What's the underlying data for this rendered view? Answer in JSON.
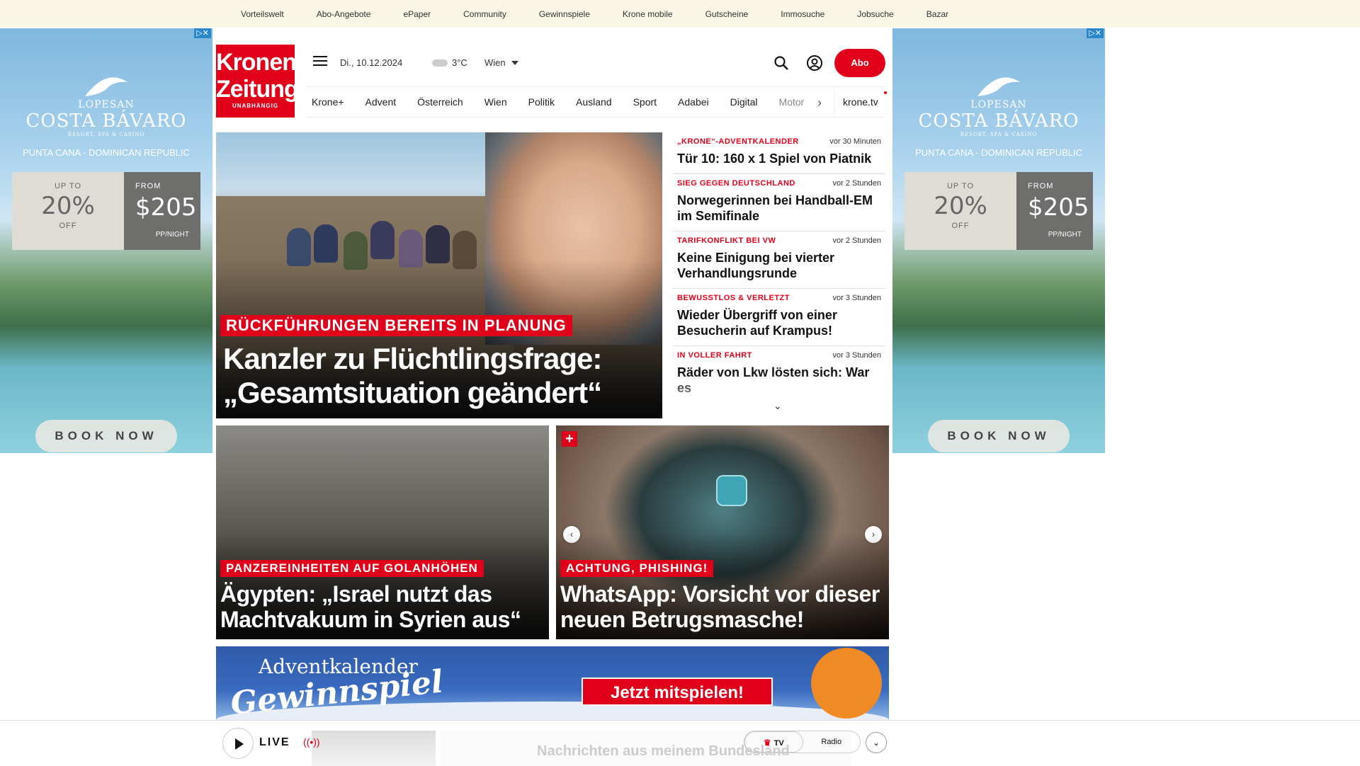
{
  "topbar": {
    "links": [
      "Vorteilswelt",
      "Abo-Angebote",
      "ePaper",
      "Community",
      "Gewinnspiele",
      "Krone mobile",
      "Gutscheine",
      "Immosuche",
      "Jobsuche",
      "Bazar"
    ]
  },
  "ads": {
    "brand_top": "LOPESAN",
    "brand_name": "COSTA BÁVARO",
    "brand_sub": "RESORT, SPA & CASINO",
    "location": "PUNTA CANA - DOMINICAN REPUBLIC",
    "upto_label": "UP TO",
    "upto_value": "20%",
    "off_label": "OFF",
    "from_label": "FROM",
    "from_value": "$205",
    "ppnight": "PP/NIGHT",
    "book": "BOOK NOW"
  },
  "logo": {
    "line1": "Kronen",
    "line2": "Zeitung",
    "tagline": "UNABHÄNGIG"
  },
  "header": {
    "date": "Di., 10.12.2024",
    "temp": "3°C",
    "city": "Wien",
    "abo": "Abo"
  },
  "nav": {
    "items": [
      "Krone+",
      "Advent",
      "Österreich",
      "Wien",
      "Politik",
      "Ausland",
      "Sport",
      "Adabei",
      "Digital"
    ],
    "partial": "Motor",
    "tv": "krone.tv"
  },
  "hero": {
    "kicker": "RÜCKFÜHRUNGEN BEREITS IN PLANUNG",
    "title": "Kanzler zu Flüchtlingsfrage: „Gesamtsituation geändert“"
  },
  "ticker": [
    {
      "kicker": "„KRONE“-ADVENTKALENDER",
      "time": "vor 30 Minuten",
      "headline": "Tür 10: 160 x 1 Spiel von Piatnik"
    },
    {
      "kicker": "SIEG GEGEN DEUTSCHLAND",
      "time": "vor 2 Stunden",
      "headline": "Norwegerinnen bei Handball-EM im Semifinale"
    },
    {
      "kicker": "TARIFKONFLIKT BEI VW",
      "time": "vor 2 Stunden",
      "headline": "Keine Einigung bei vierter Verhandlungsrunde"
    },
    {
      "kicker": "BEWUSSTLOS & VERLETZT",
      "time": "vor 3 Stunden",
      "headline": "Wieder Übergriff von einer Besucherin auf Krampus!"
    },
    {
      "kicker": "IN VOLLER FAHRT",
      "time": "vor 3 Stunden",
      "headline": "Räder von Lkw lösten sich: War es"
    }
  ],
  "cards": [
    {
      "kicker": "PANZEREINHEITEN AUF GOLANHÖHEN",
      "title": "Ägypten: „Israel nutzt das Machtvakuum in Syrien aus“"
    },
    {
      "kicker": "ACHTUNG, PHISHING!",
      "title": "WhatsApp: Vorsicht vor dieser neuen Betrugsmasche!"
    }
  ],
  "banner": {
    "line1": "Adventkalender",
    "line2": "Gewinnspiel",
    "button": "Jetzt mitspielen!"
  },
  "player": {
    "live": "LIVE",
    "faded_text": "Nachrichten aus meinem Bundesland",
    "tv": "TV",
    "radio": "Radio"
  },
  "colors": {
    "accent": "#e1001a",
    "topbar_bg": "#f9f6e6"
  }
}
